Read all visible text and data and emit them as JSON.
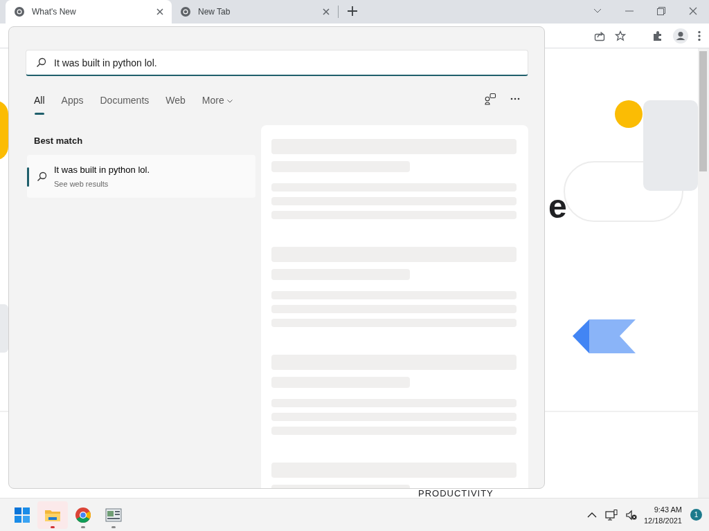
{
  "browser": {
    "tabs": [
      {
        "title": "What's New",
        "selected": true
      },
      {
        "title": "New Tab",
        "selected": false
      }
    ]
  },
  "search": {
    "query": "It was built in python lol.",
    "filters": [
      {
        "label": "All",
        "selected": true,
        "dropdown": false
      },
      {
        "label": "Apps",
        "selected": false,
        "dropdown": false
      },
      {
        "label": "Documents",
        "selected": false,
        "dropdown": false
      },
      {
        "label": "Web",
        "selected": false,
        "dropdown": false
      },
      {
        "label": "More",
        "selected": false,
        "dropdown": true
      }
    ],
    "best_match_heading": "Best match",
    "results": [
      {
        "title": "It was built in python lol.",
        "subtitle": "See web results",
        "selected": true
      }
    ]
  },
  "page": {
    "heading_fragment": "e",
    "section_label": "PRODUCTIVITY"
  },
  "taskbar": {
    "apps": [
      {
        "kind": "explorer",
        "selected": true
      },
      {
        "kind": "chrome",
        "selected": false
      },
      {
        "kind": "document",
        "selected": false
      }
    ],
    "time": "9:43 AM",
    "date": "12/18/2021",
    "notification_count": "1"
  }
}
